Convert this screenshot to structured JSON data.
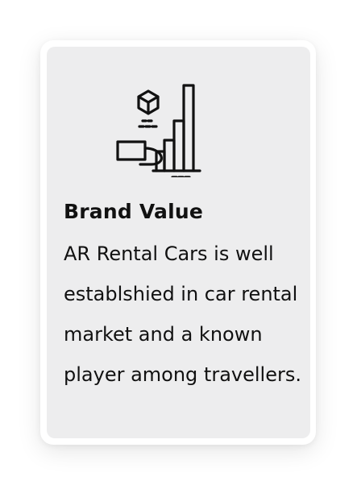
{
  "card": {
    "icon": "brand-growth-icon",
    "title": "Brand Value",
    "description": "AR Rental Cars is well establshied in car rental market and a known player among travellers."
  },
  "colors": {
    "page_background": "#ffffff",
    "card_background": "#ededee",
    "text": "#111111"
  }
}
